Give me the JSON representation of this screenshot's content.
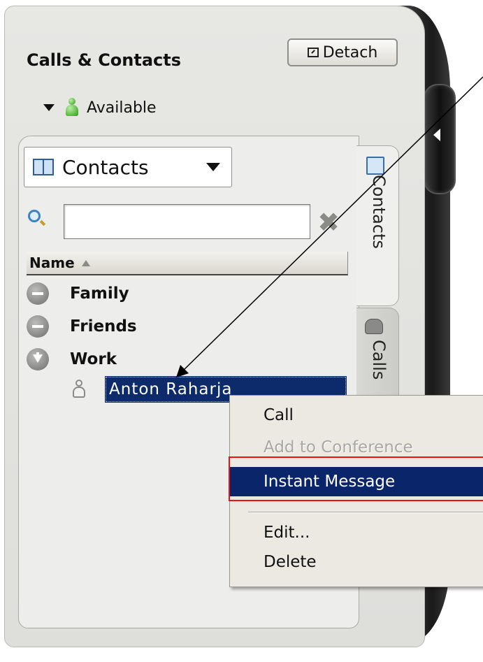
{
  "panel": {
    "title": "Calls & Contacts",
    "detach_label": "Detach",
    "status": "Available"
  },
  "contacts": {
    "selector_label": "Contacts",
    "search": {
      "value": "",
      "placeholder": ""
    },
    "column_header": "Name",
    "groups": [
      {
        "label": "Family",
        "state": "expanded"
      },
      {
        "label": "Friends",
        "state": "expanded"
      },
      {
        "label": "Work",
        "state": "collapsed"
      }
    ],
    "selected_contact": "Anton Raharja"
  },
  "side_tabs": [
    {
      "label": "Contacts",
      "icon": "book-icon",
      "active": true
    },
    {
      "label": "Calls",
      "icon": "phone-icon",
      "active": false
    }
  ],
  "context_menu": {
    "items": [
      {
        "label": "Call",
        "enabled": true
      },
      {
        "label": "Add to Conference",
        "enabled": false
      },
      {
        "label": "Instant Message",
        "enabled": true,
        "highlighted": true
      },
      {
        "label": "Edit...",
        "enabled": true
      },
      {
        "label": "Delete",
        "enabled": true
      }
    ]
  },
  "colors": {
    "selection": "#0d2a6b",
    "menu_highlight": "#0b256a",
    "annotation_box": "#e11111",
    "status_green": "#2c9a18"
  }
}
